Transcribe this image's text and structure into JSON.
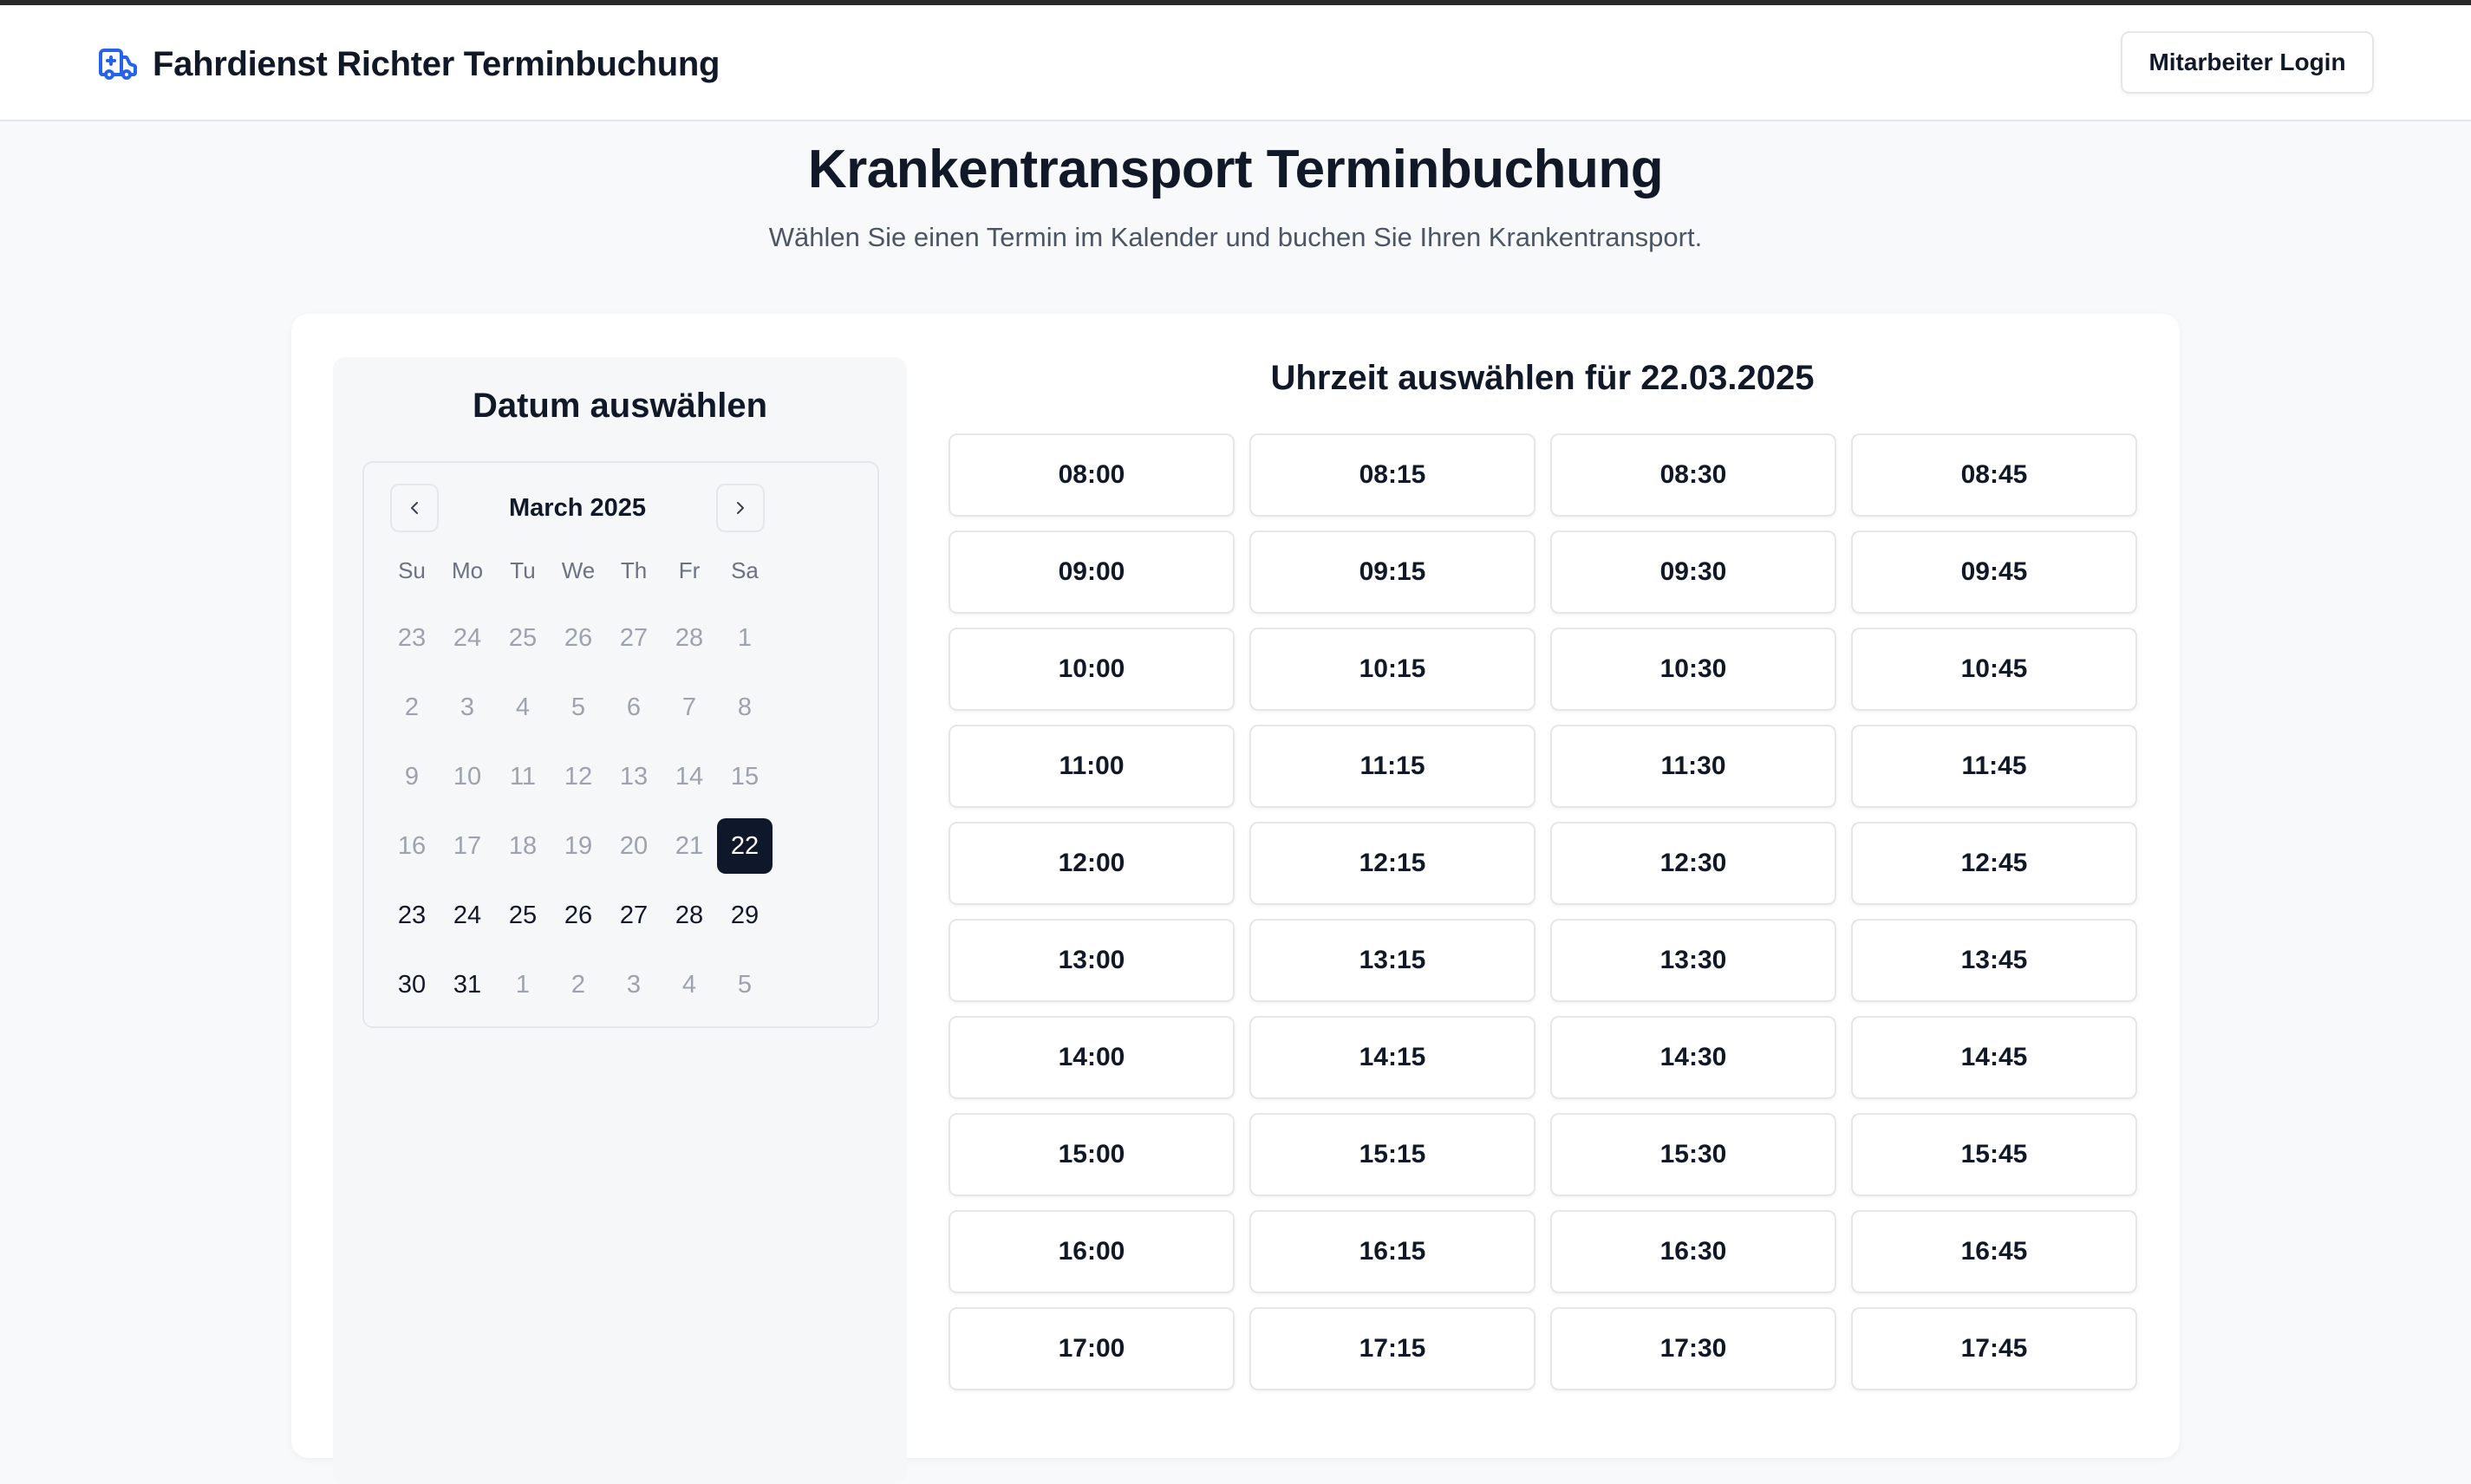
{
  "header": {
    "brand_title": "Fahrdienst Richter Terminbuchung",
    "brand_icon": "ambulance-icon",
    "login_label": "Mitarbeiter Login"
  },
  "main": {
    "title": "Krankentransport Terminbuchung",
    "subtitle": "Wählen Sie einen Termin im Kalender und buchen Sie Ihren Krankentransport."
  },
  "calendar": {
    "title": "Datum auswählen",
    "month_label": "March 2025",
    "prev_icon": "chevron-left-icon",
    "next_icon": "chevron-right-icon",
    "weekdays": [
      "Su",
      "Mo",
      "Tu",
      "We",
      "Th",
      "Fr",
      "Sa"
    ],
    "days": [
      {
        "label": "23",
        "state": "muted"
      },
      {
        "label": "24",
        "state": "muted"
      },
      {
        "label": "25",
        "state": "muted"
      },
      {
        "label": "26",
        "state": "muted"
      },
      {
        "label": "27",
        "state": "muted"
      },
      {
        "label": "28",
        "state": "muted"
      },
      {
        "label": "1",
        "state": "muted"
      },
      {
        "label": "2",
        "state": "muted"
      },
      {
        "label": "3",
        "state": "muted"
      },
      {
        "label": "4",
        "state": "muted"
      },
      {
        "label": "5",
        "state": "muted"
      },
      {
        "label": "6",
        "state": "muted"
      },
      {
        "label": "7",
        "state": "muted"
      },
      {
        "label": "8",
        "state": "muted"
      },
      {
        "label": "9",
        "state": "muted"
      },
      {
        "label": "10",
        "state": "muted"
      },
      {
        "label": "11",
        "state": "muted"
      },
      {
        "label": "12",
        "state": "muted"
      },
      {
        "label": "13",
        "state": "muted"
      },
      {
        "label": "14",
        "state": "muted"
      },
      {
        "label": "15",
        "state": "muted"
      },
      {
        "label": "16",
        "state": "muted"
      },
      {
        "label": "17",
        "state": "muted"
      },
      {
        "label": "18",
        "state": "muted"
      },
      {
        "label": "19",
        "state": "muted"
      },
      {
        "label": "20",
        "state": "muted"
      },
      {
        "label": "21",
        "state": "muted"
      },
      {
        "label": "22",
        "state": "selected"
      },
      {
        "label": "23",
        "state": "active"
      },
      {
        "label": "24",
        "state": "active"
      },
      {
        "label": "25",
        "state": "active"
      },
      {
        "label": "26",
        "state": "active"
      },
      {
        "label": "27",
        "state": "active"
      },
      {
        "label": "28",
        "state": "active"
      },
      {
        "label": "29",
        "state": "active"
      },
      {
        "label": "30",
        "state": "active"
      },
      {
        "label": "31",
        "state": "active"
      },
      {
        "label": "1",
        "state": "muted"
      },
      {
        "label": "2",
        "state": "muted"
      },
      {
        "label": "3",
        "state": "muted"
      },
      {
        "label": "4",
        "state": "muted"
      },
      {
        "label": "5",
        "state": "muted"
      }
    ]
  },
  "timeslots": {
    "title": "Uhrzeit auswählen für 22.03.2025",
    "slots": [
      "08:00",
      "08:15",
      "08:30",
      "08:45",
      "09:00",
      "09:15",
      "09:30",
      "09:45",
      "10:00",
      "10:15",
      "10:30",
      "10:45",
      "11:00",
      "11:15",
      "11:30",
      "11:45",
      "12:00",
      "12:15",
      "12:30",
      "12:45",
      "13:00",
      "13:15",
      "13:30",
      "13:45",
      "14:00",
      "14:15",
      "14:30",
      "14:45",
      "15:00",
      "15:15",
      "15:30",
      "15:45",
      "16:00",
      "16:15",
      "16:30",
      "16:45",
      "17:00",
      "17:15",
      "17:30",
      "17:45"
    ]
  },
  "colors": {
    "accent_icon": "#2563eb",
    "selected_day_bg": "#0f172a",
    "page_bg": "#f8f9fb"
  }
}
